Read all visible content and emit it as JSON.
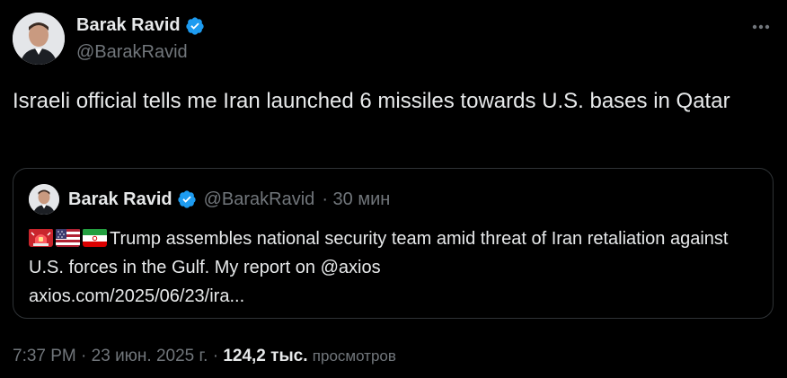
{
  "author": {
    "name": "Barak Ravid",
    "handle": "@BarakRavid"
  },
  "tweet": {
    "text": "Israeli official tells me Iran launched 6 missiles towards U.S. bases in Qatar"
  },
  "quote": {
    "name": "Barak Ravid",
    "handle": "@BarakRavid",
    "time": "· 30 мин",
    "emojis": [
      "rotating-light",
      "us-flag",
      "iran-flag"
    ],
    "text": "Trump assembles national security team amid threat of Iran retaliation against U.S. forces in the Gulf. My report on @axios",
    "link": "axios.com/2025/06/23/ira..."
  },
  "footer": {
    "time": "7:37 PM",
    "date": "· 23 июн. 2025 г. ·",
    "views": "124,2 тыс.",
    "views_label": "просмотров"
  },
  "colors": {
    "background": "#000000",
    "text": "#e7e9ea",
    "muted": "#71767b",
    "border": "#2f3336",
    "verified": "#1d9bf0"
  }
}
